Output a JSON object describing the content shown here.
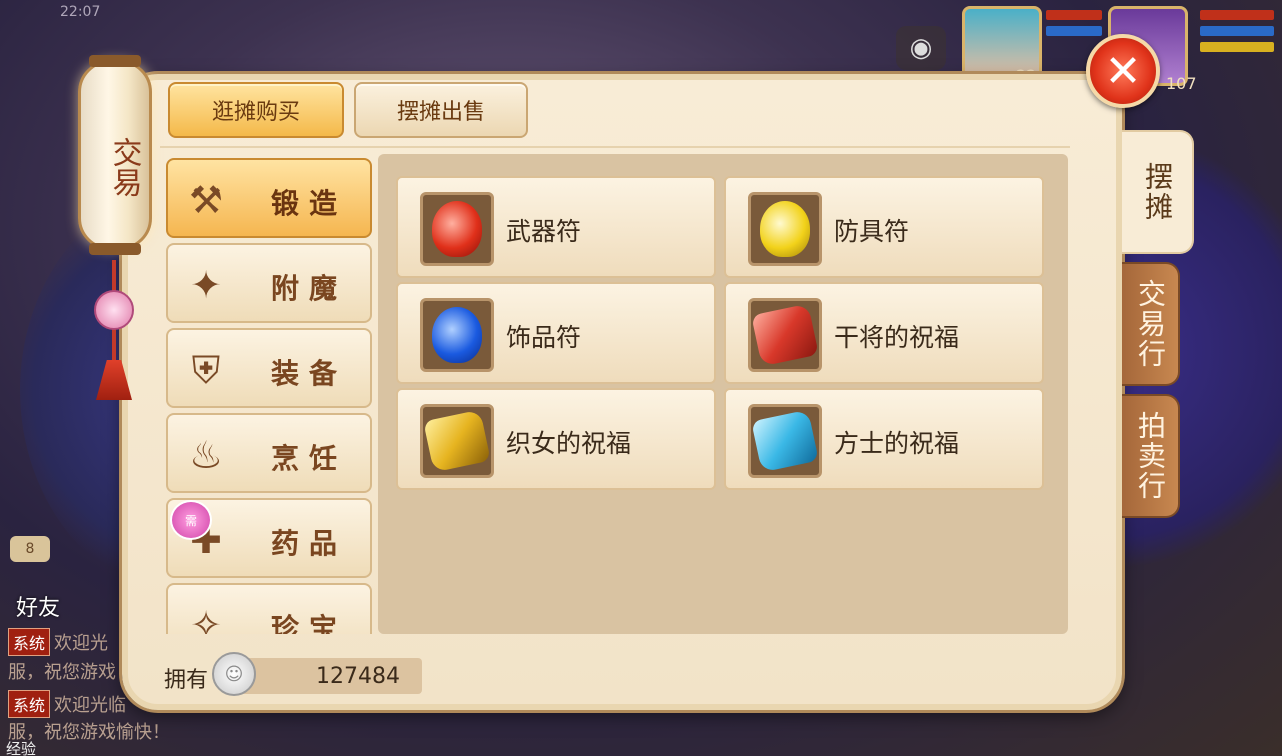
{
  "status_bar": {
    "time": "22:07"
  },
  "lantern": {
    "label": "交易"
  },
  "top_tabs": {
    "buy_label": "逛摊购买",
    "sell_label": "摆摊出售"
  },
  "categories": [
    {
      "label": "锻造",
      "icon": "hammer-icon",
      "glyph": "🔨"
    },
    {
      "label": "附魔",
      "icon": "magic-wand-icon",
      "glyph": "✦"
    },
    {
      "label": "装备",
      "icon": "armor-icon",
      "glyph": "⛨"
    },
    {
      "label": "烹饪",
      "icon": "cooking-pot-icon",
      "glyph": "♨"
    },
    {
      "label": "药品",
      "icon": "medicine-icon",
      "glyph": "✚"
    },
    {
      "label": "珍宝",
      "icon": "treasure-icon",
      "glyph": "✧"
    }
  ],
  "need_badge": {
    "text": "需"
  },
  "items": [
    {
      "name": "武器符",
      "icon": "red-talisman-icon",
      "color": "#e0301a"
    },
    {
      "name": "防具符",
      "icon": "yellow-talisman-icon",
      "color": "#f2d21a"
    },
    {
      "name": "饰品符",
      "icon": "blue-talisman-icon",
      "color": "#1a5ae0"
    },
    {
      "name": "干将的祝福",
      "icon": "red-scroll-icon",
      "color": "#d8382a"
    },
    {
      "name": "织女的祝福",
      "icon": "gold-scroll-icon",
      "color": "#e6b420"
    },
    {
      "name": "方士的祝福",
      "icon": "cyan-scroll-icon",
      "color": "#3ab8e6"
    }
  ],
  "side_tabs": {
    "stall": "摆摊",
    "trade": "交易行",
    "auction": "拍卖行"
  },
  "currency": {
    "label": "拥有",
    "amount": "127484",
    "icon": "silver-coin-icon"
  },
  "hud": {
    "level_pet": "22",
    "level_player": "107"
  },
  "chat": {
    "friend_label": "好友",
    "unread": "8",
    "lines": [
      {
        "tag": "系统",
        "text": "欢迎光"
      },
      {
        "tag": "",
        "text": "服，祝您游戏"
      },
      {
        "tag": "系统",
        "text": "欢迎光临"
      },
      {
        "tag": "",
        "text": "服，祝您游戏愉快！"
      }
    ],
    "exp_label": "经验"
  }
}
